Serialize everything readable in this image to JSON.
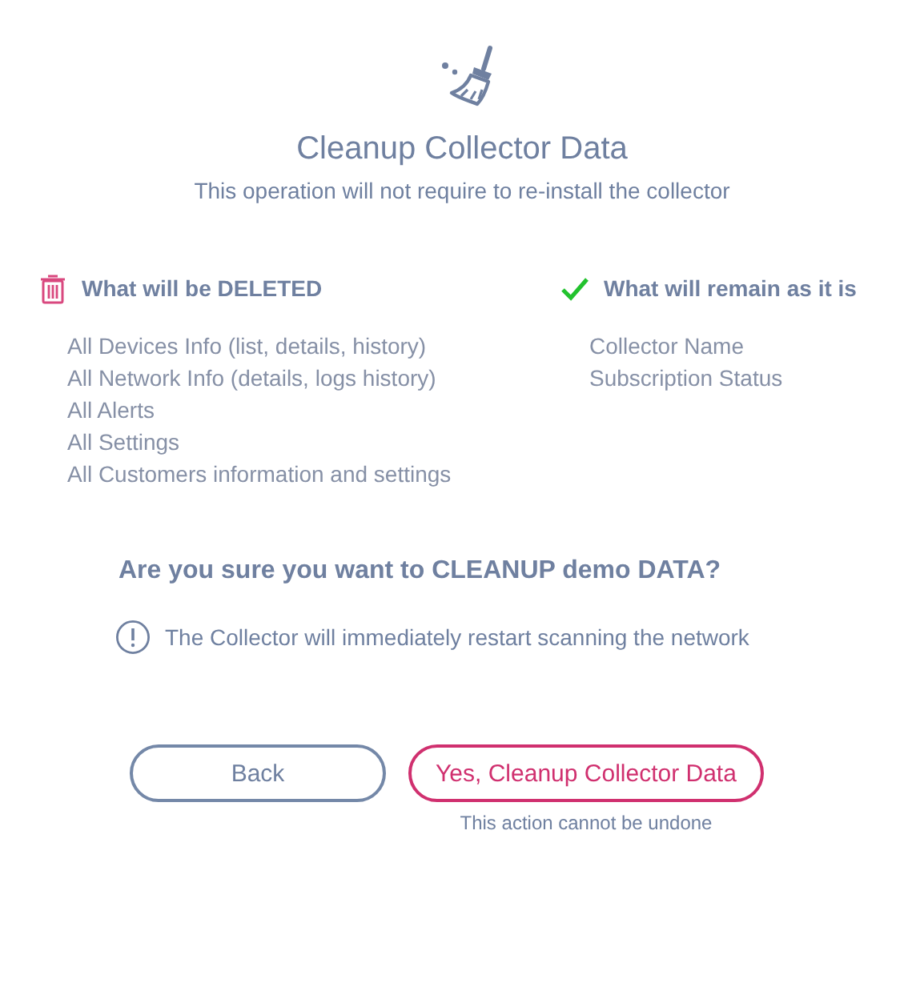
{
  "header": {
    "title": "Cleanup Collector Data",
    "subtitle": "This operation will not require to re-install the collector"
  },
  "columns": [
    {
      "kind": "deleted",
      "heading": "What will be DELETED",
      "items": [
        "All Devices Info (list, details, history)",
        "All Network Info (details, logs history)",
        "All Alerts",
        "All Settings",
        "All Customers information and settings"
      ]
    },
    {
      "kind": "kept",
      "heading": "What will remain as it is",
      "items": [
        "Collector Name",
        "Subscription Status"
      ]
    }
  ],
  "question": "Are you sure you want to CLEANUP demo DATA?",
  "warning": "The Collector will immediately restart scanning the network",
  "buttons": [
    {
      "kind": "secondary",
      "label": "Back"
    },
    {
      "kind": "danger",
      "label": "Yes, Cleanup Collector Data",
      "note": "This action cannot be undone"
    }
  ]
}
